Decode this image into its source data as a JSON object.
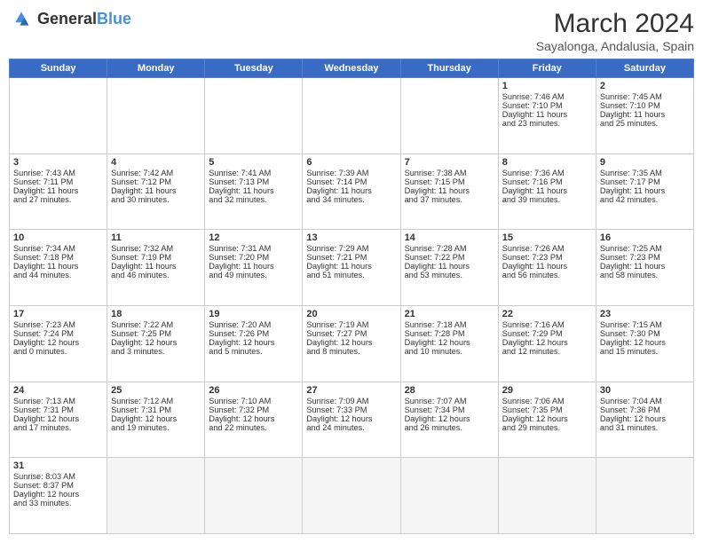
{
  "header": {
    "logo_general": "General",
    "logo_blue": "Blue",
    "month_year": "March 2024",
    "location": "Sayalonga, Andalusia, Spain"
  },
  "days_of_week": [
    "Sunday",
    "Monday",
    "Tuesday",
    "Wednesday",
    "Thursday",
    "Friday",
    "Saturday"
  ],
  "weeks": [
    [
      {
        "day": "",
        "info": ""
      },
      {
        "day": "",
        "info": ""
      },
      {
        "day": "",
        "info": ""
      },
      {
        "day": "",
        "info": ""
      },
      {
        "day": "",
        "info": ""
      },
      {
        "day": "1",
        "info": "Sunrise: 7:46 AM\nSunset: 7:10 PM\nDaylight: 11 hours\nand 23 minutes."
      },
      {
        "day": "2",
        "info": "Sunrise: 7:45 AM\nSunset: 7:10 PM\nDaylight: 11 hours\nand 25 minutes."
      }
    ],
    [
      {
        "day": "3",
        "info": "Sunrise: 7:43 AM\nSunset: 7:11 PM\nDaylight: 11 hours\nand 27 minutes."
      },
      {
        "day": "4",
        "info": "Sunrise: 7:42 AM\nSunset: 7:12 PM\nDaylight: 11 hours\nand 30 minutes."
      },
      {
        "day": "5",
        "info": "Sunrise: 7:41 AM\nSunset: 7:13 PM\nDaylight: 11 hours\nand 32 minutes."
      },
      {
        "day": "6",
        "info": "Sunrise: 7:39 AM\nSunset: 7:14 PM\nDaylight: 11 hours\nand 34 minutes."
      },
      {
        "day": "7",
        "info": "Sunrise: 7:38 AM\nSunset: 7:15 PM\nDaylight: 11 hours\nand 37 minutes."
      },
      {
        "day": "8",
        "info": "Sunrise: 7:36 AM\nSunset: 7:16 PM\nDaylight: 11 hours\nand 39 minutes."
      },
      {
        "day": "9",
        "info": "Sunrise: 7:35 AM\nSunset: 7:17 PM\nDaylight: 11 hours\nand 42 minutes."
      }
    ],
    [
      {
        "day": "10",
        "info": "Sunrise: 7:34 AM\nSunset: 7:18 PM\nDaylight: 11 hours\nand 44 minutes."
      },
      {
        "day": "11",
        "info": "Sunrise: 7:32 AM\nSunset: 7:19 PM\nDaylight: 11 hours\nand 46 minutes."
      },
      {
        "day": "12",
        "info": "Sunrise: 7:31 AM\nSunset: 7:20 PM\nDaylight: 11 hours\nand 49 minutes."
      },
      {
        "day": "13",
        "info": "Sunrise: 7:29 AM\nSunset: 7:21 PM\nDaylight: 11 hours\nand 51 minutes."
      },
      {
        "day": "14",
        "info": "Sunrise: 7:28 AM\nSunset: 7:22 PM\nDaylight: 11 hours\nand 53 minutes."
      },
      {
        "day": "15",
        "info": "Sunrise: 7:26 AM\nSunset: 7:23 PM\nDaylight: 11 hours\nand 56 minutes."
      },
      {
        "day": "16",
        "info": "Sunrise: 7:25 AM\nSunset: 7:23 PM\nDaylight: 11 hours\nand 58 minutes."
      }
    ],
    [
      {
        "day": "17",
        "info": "Sunrise: 7:23 AM\nSunset: 7:24 PM\nDaylight: 12 hours\nand 0 minutes."
      },
      {
        "day": "18",
        "info": "Sunrise: 7:22 AM\nSunset: 7:25 PM\nDaylight: 12 hours\nand 3 minutes."
      },
      {
        "day": "19",
        "info": "Sunrise: 7:20 AM\nSunset: 7:26 PM\nDaylight: 12 hours\nand 5 minutes."
      },
      {
        "day": "20",
        "info": "Sunrise: 7:19 AM\nSunset: 7:27 PM\nDaylight: 12 hours\nand 8 minutes."
      },
      {
        "day": "21",
        "info": "Sunrise: 7:18 AM\nSunset: 7:28 PM\nDaylight: 12 hours\nand 10 minutes."
      },
      {
        "day": "22",
        "info": "Sunrise: 7:16 AM\nSunset: 7:29 PM\nDaylight: 12 hours\nand 12 minutes."
      },
      {
        "day": "23",
        "info": "Sunrise: 7:15 AM\nSunset: 7:30 PM\nDaylight: 12 hours\nand 15 minutes."
      }
    ],
    [
      {
        "day": "24",
        "info": "Sunrise: 7:13 AM\nSunset: 7:31 PM\nDaylight: 12 hours\nand 17 minutes."
      },
      {
        "day": "25",
        "info": "Sunrise: 7:12 AM\nSunset: 7:31 PM\nDaylight: 12 hours\nand 19 minutes."
      },
      {
        "day": "26",
        "info": "Sunrise: 7:10 AM\nSunset: 7:32 PM\nDaylight: 12 hours\nand 22 minutes."
      },
      {
        "day": "27",
        "info": "Sunrise: 7:09 AM\nSunset: 7:33 PM\nDaylight: 12 hours\nand 24 minutes."
      },
      {
        "day": "28",
        "info": "Sunrise: 7:07 AM\nSunset: 7:34 PM\nDaylight: 12 hours\nand 26 minutes."
      },
      {
        "day": "29",
        "info": "Sunrise: 7:06 AM\nSunset: 7:35 PM\nDaylight: 12 hours\nand 29 minutes."
      },
      {
        "day": "30",
        "info": "Sunrise: 7:04 AM\nSunset: 7:36 PM\nDaylight: 12 hours\nand 31 minutes."
      }
    ],
    [
      {
        "day": "31",
        "info": "Sunrise: 8:03 AM\nSunset: 8:37 PM\nDaylight: 12 hours\nand 33 minutes."
      },
      {
        "day": "",
        "info": ""
      },
      {
        "day": "",
        "info": ""
      },
      {
        "day": "",
        "info": ""
      },
      {
        "day": "",
        "info": ""
      },
      {
        "day": "",
        "info": ""
      },
      {
        "day": "",
        "info": ""
      }
    ]
  ]
}
